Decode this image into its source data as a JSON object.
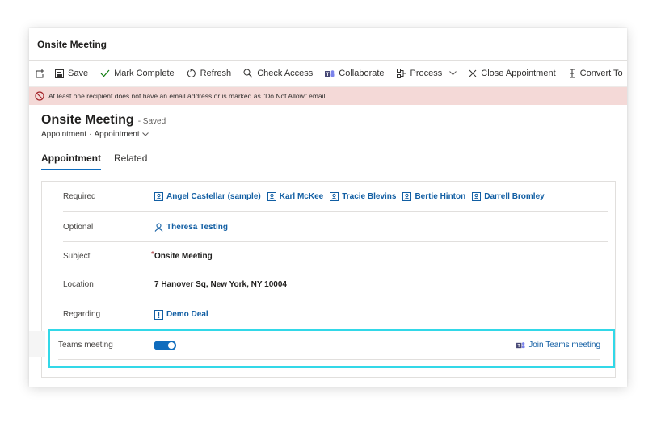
{
  "window": {
    "title": "Onsite Meeting"
  },
  "toolbar": {
    "save": "Save",
    "mark_complete": "Mark Complete",
    "refresh": "Refresh",
    "check_access": "Check Access",
    "collaborate": "Collaborate",
    "process": "Process",
    "close_appointment": "Close Appointment",
    "convert_to": "Convert To"
  },
  "alert": {
    "text": "At least one recipient does not have an email address or is marked as \"Do Not Allow\" email."
  },
  "record": {
    "title": "Onsite Meeting",
    "status": "- Saved",
    "entity": "Appointment",
    "form": "Appointment"
  },
  "tabs": [
    "Appointment",
    "Related"
  ],
  "fields": {
    "required": {
      "label": "Required",
      "values": [
        "Angel Castellar (sample)",
        "Karl McKee",
        "Tracie Blevins",
        "Bertie Hinton",
        "Darrell Bromley"
      ]
    },
    "optional": {
      "label": "Optional",
      "value": "Theresa Testing"
    },
    "subject": {
      "label": "Subject",
      "value": "Onsite Meeting"
    },
    "location": {
      "label": "Location",
      "value": "7 Hanover Sq, New York, NY 10004"
    },
    "regarding": {
      "label": "Regarding",
      "value": "Demo Deal"
    },
    "teams": {
      "label": "Teams meeting",
      "enabled": true,
      "join_label": "Join Teams meeting"
    }
  },
  "colors": {
    "accent": "#0f6cbd",
    "link": "#115ea3",
    "alert_bg": "#f4d9d7",
    "highlight": "#32d8e8"
  }
}
